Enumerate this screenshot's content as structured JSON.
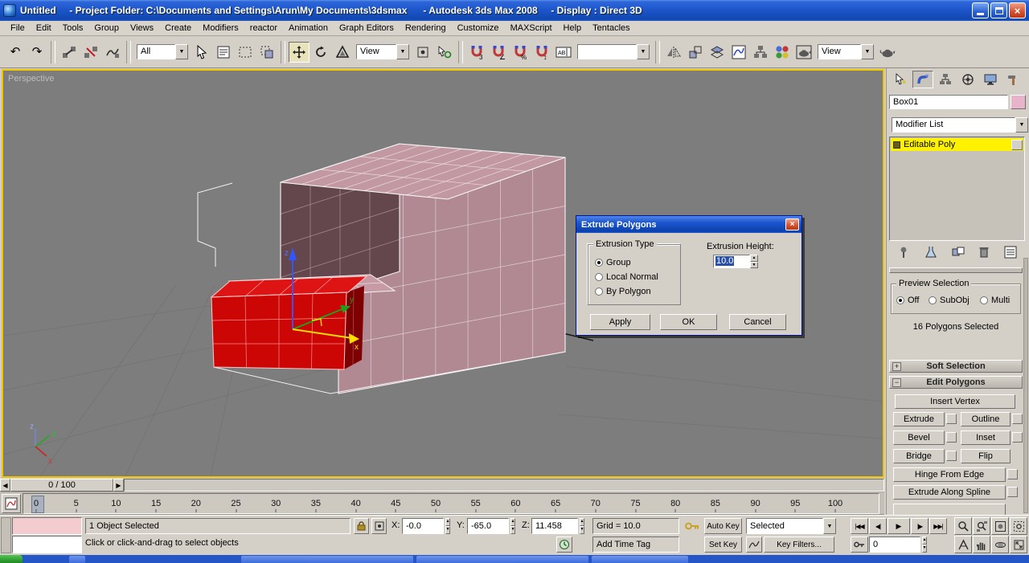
{
  "window": {
    "title": "Untitled     - Project Folder: C:\\Documents and Settings\\Arun\\My Documents\\3dsmax      - Autodesk 3ds Max 2008     - Display : Direct 3D"
  },
  "menu": {
    "items": [
      "File",
      "Edit",
      "Tools",
      "Group",
      "Views",
      "Create",
      "Modifiers",
      "reactor",
      "Animation",
      "Graph Editors",
      "Rendering",
      "Customize",
      "MAXScript",
      "Help",
      "Tentacles"
    ]
  },
  "toolbar": {
    "selection_filter": "All",
    "coord_system": "View",
    "render_type": "View"
  },
  "viewport": {
    "label": "Perspective",
    "gizmo": {
      "x": "x",
      "y": "y",
      "z": "z"
    },
    "tripod": {
      "x": "x",
      "y": "y",
      "z": "z"
    }
  },
  "dialog": {
    "title": "Extrude Polygons",
    "group_title": "Extrusion Type",
    "radios": [
      "Group",
      "Local Normal",
      "By Polygon"
    ],
    "height_label": "Extrusion Height:",
    "height_value": "10.0",
    "apply": "Apply",
    "ok": "OK",
    "cancel": "Cancel"
  },
  "panel": {
    "object_name": "Box01",
    "modifier_list": "Modifier List",
    "stack_item": "Editable Poly",
    "preview": {
      "title": "Preview Selection",
      "options": [
        "Off",
        "SubObj",
        "Multi"
      ],
      "status": "16 Polygons Selected"
    },
    "soft_selection": "Soft Selection",
    "edit_polygons": "Edit Polygons",
    "buttons": {
      "insert_vertex": "Insert Vertex",
      "extrude": "Extrude",
      "outline": "Outline",
      "bevel": "Bevel",
      "inset": "Inset",
      "bridge": "Bridge",
      "flip": "Flip",
      "hinge": "Hinge From Edge",
      "extrude_spline": "Extrude Along Spline"
    }
  },
  "timeline": {
    "slider": "0 / 100",
    "ticks": [
      "0",
      "5",
      "10",
      "15",
      "20",
      "25",
      "30",
      "35",
      "40",
      "45",
      "50",
      "55",
      "60",
      "65",
      "70",
      "75",
      "80",
      "85",
      "90",
      "95",
      "100"
    ]
  },
  "status": {
    "selection": "1 Object Selected",
    "x_label": "X:",
    "x": "-0.0",
    "y_label": "Y:",
    "y": "-65.0",
    "z_label": "Z:",
    "z": "11.458",
    "grid": "Grid = 10.0",
    "prompt": "Click or click-and-drag to select objects",
    "time_tag": "Add Time Tag",
    "auto_key": "Auto Key",
    "set_key": "Set Key",
    "key_mode": "Selected",
    "key_filters": "Key Filters...",
    "frame": "0"
  }
}
